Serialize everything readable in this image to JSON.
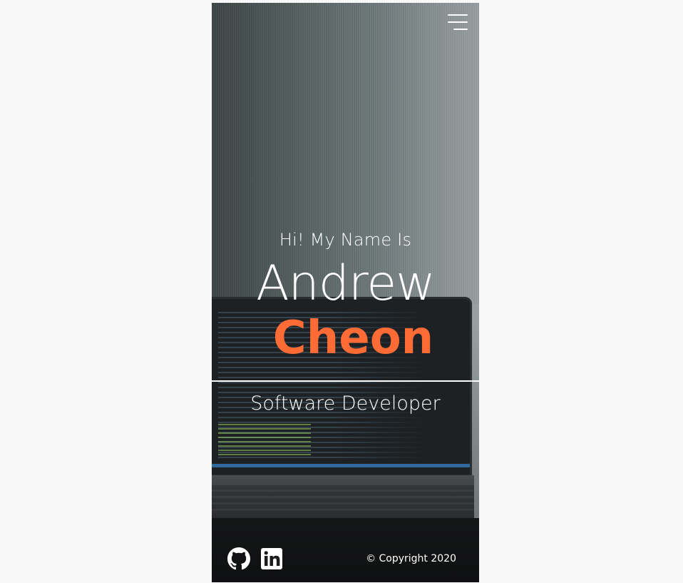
{
  "menu": {
    "icon": "hamburger-menu-icon"
  },
  "hero": {
    "greeting": "Hi! My Name Is",
    "first_name": "Andrew",
    "last_name": "Cheon",
    "role": "Software Developer"
  },
  "footer": {
    "github_icon": "github-icon",
    "linkedin_icon": "linkedin-icon",
    "copyright": "© Copyright 2020"
  },
  "colors": {
    "accent": "#ff6b35",
    "text": "#ffffff",
    "page_bg": "#f8f8f8"
  }
}
